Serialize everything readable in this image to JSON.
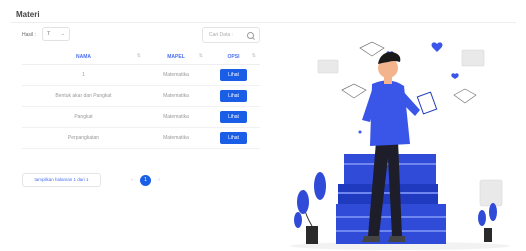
{
  "page": {
    "title": "Materi"
  },
  "controls": {
    "show_label": "Hasil :",
    "show_value": "7",
    "search_placeholder": "Cari Data :"
  },
  "table": {
    "headers": [
      "NAMA",
      "MAPEL",
      "OPSI"
    ],
    "rows": [
      {
        "nama": "1",
        "mapel": "Matematika",
        "opsi": "Lihat"
      },
      {
        "nama": "Bentuk akar dan Pangkat",
        "mapel": "Matematika",
        "opsi": "Lihat"
      },
      {
        "nama": "Pangkat",
        "mapel": "Matematika",
        "opsi": "Lihat"
      },
      {
        "nama": "Perpangkatan",
        "mapel": "Matematika",
        "opsi": "Lihat"
      }
    ]
  },
  "pagination": {
    "info": "tampilkan halaman 1 dari 1",
    "prev": "‹",
    "current": "1",
    "next": "›"
  },
  "colors": {
    "primary": "#1a5de6",
    "header_text": "#4a6ef0"
  }
}
